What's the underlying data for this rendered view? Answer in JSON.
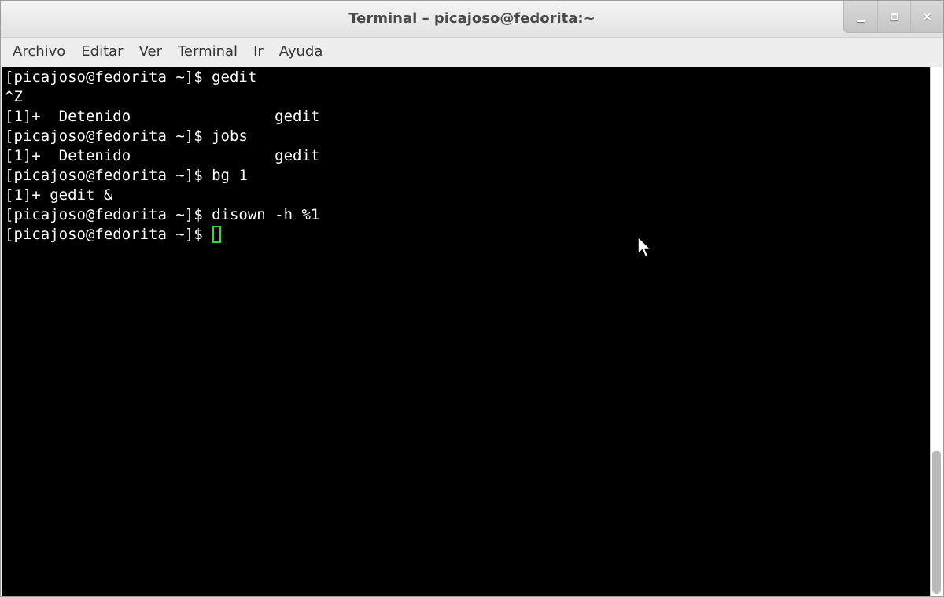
{
  "window": {
    "title": "Terminal – picajoso@fedorita:~"
  },
  "window_controls": {
    "minimize_icon": "minimize-icon",
    "maximize_icon": "maximize-icon",
    "close_icon": "close-icon",
    "close_glyph": "✕"
  },
  "menubar": {
    "items": [
      "Archivo",
      "Editar",
      "Ver",
      "Terminal",
      "Ir",
      "Ayuda"
    ]
  },
  "terminal": {
    "lines": [
      "[picajoso@fedorita ~]$ gedit",
      "^Z",
      "[1]+  Detenido                gedit",
      "[picajoso@fedorita ~]$ jobs",
      "[1]+  Detenido                gedit",
      "[picajoso@fedorita ~]$ bg 1",
      "[1]+ gedit &",
      "[picajoso@fedorita ~]$ disown -h %1",
      "[picajoso@fedorita ~]$ "
    ],
    "background_color": "#000000",
    "text_color": "#ffffff",
    "cursor_color": "#2ee02e"
  },
  "scrollbar": {
    "position_fraction": 0.73
  }
}
